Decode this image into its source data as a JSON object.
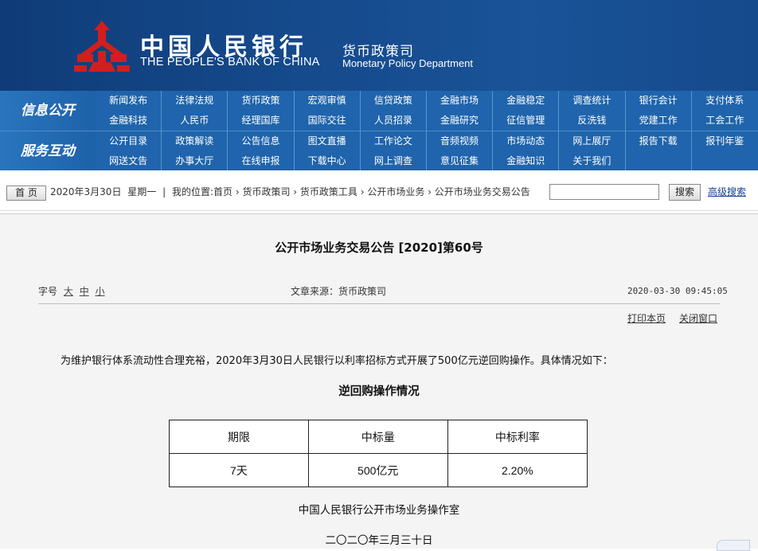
{
  "header": {
    "bank_name_cn": "中国人民银行",
    "bank_name_en": "THE PEOPLE'S BANK OF CHINA",
    "dept_cn": "货币政策司",
    "dept_en": "Monetary Policy Department",
    "colors": {
      "banner": "#154a8c",
      "logo_red": "#d21e1e",
      "nav": "#1f64ac"
    }
  },
  "nav": {
    "group1_label": "信息公开",
    "group1_items": [
      "新闻发布",
      "法律法规",
      "货币政策",
      "宏观审慎",
      "信贷政策",
      "金融市场",
      "金融稳定",
      "调查统计",
      "银行会计",
      "支付体系",
      "金融科技",
      "人民币",
      "经理国库",
      "国际交往",
      "人员招录",
      "金融研究",
      "征信管理",
      "反洗钱",
      "党建工作",
      "工会工作"
    ],
    "group2_label": "服务互动",
    "group2_items": [
      "公开目录",
      "政策解读",
      "公告信息",
      "图文直播",
      "工作论文",
      "音频视频",
      "市场动态",
      "网上展厅",
      "报告下载",
      "报刊年鉴",
      "网送文告",
      "办事大厅",
      "在线申报",
      "下载中心",
      "网上调查",
      "意见征集",
      "金融知识",
      "关于我们",
      "",
      ""
    ]
  },
  "crumb": {
    "home_btn": "首 页",
    "date": "2020年3月30日",
    "weekday": "星期一",
    "path": "我的位置:首页 › 货币政策司 › 货币政策工具 › 公开市场业务 › 公开市场业务交易公告",
    "search_btn": "搜索",
    "advanced_search": "高级搜索"
  },
  "article": {
    "title": "公开市场业务交易公告 [2020]第60号",
    "font_label": "字号",
    "font_large": "大",
    "font_medium": "中",
    "font_small": "小",
    "source": "文章来源：货币政策司",
    "time": "2020-03-30 09:45:05",
    "print": "打印本页",
    "close": "关闭窗口",
    "paragraph": "为维护银行体系流动性合理充裕，2020年3月30日人民银行以利率招标方式开展了500亿元逆回购操作。具体情况如下：",
    "subheading": "逆回购操作情况",
    "table": {
      "headers": [
        "期限",
        "中标量",
        "中标利率"
      ],
      "row": [
        "7天",
        "500亿元",
        "2.20%"
      ]
    },
    "signature": "中国人民银行公开市场业务操作室",
    "date": "二〇二〇年三月三十日"
  }
}
